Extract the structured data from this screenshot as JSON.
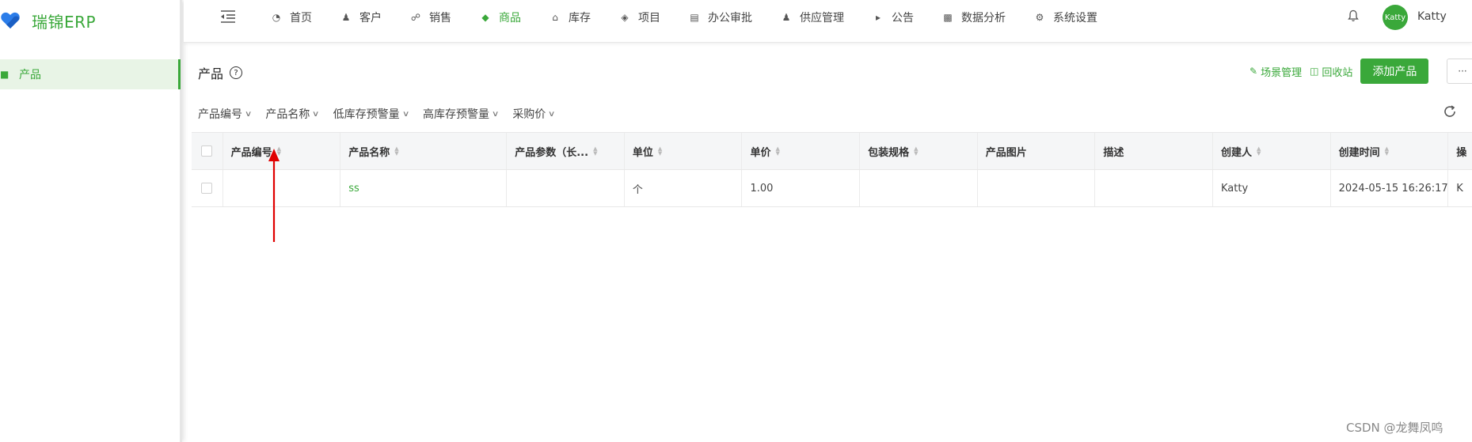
{
  "sidebar": {
    "brand": "瑞锦ERP",
    "items": [
      {
        "label": "产品",
        "icon": "monitor-icon"
      }
    ]
  },
  "topnav": {
    "items": [
      {
        "label": "首页",
        "icon": "dashboard-icon"
      },
      {
        "label": "客户",
        "icon": "users-icon"
      },
      {
        "label": "销售",
        "icon": "cart-icon"
      },
      {
        "label": "商品",
        "icon": "gem-icon",
        "active": true
      },
      {
        "label": "库存",
        "icon": "bank-icon"
      },
      {
        "label": "项目",
        "icon": "layers-icon"
      },
      {
        "label": "办公审批",
        "icon": "document-icon"
      },
      {
        "label": "供应管理",
        "icon": "user-icon"
      },
      {
        "label": "公告",
        "icon": "megaphone-icon"
      },
      {
        "label": "数据分析",
        "icon": "bar-chart-icon"
      },
      {
        "label": "系统设置",
        "icon": "gear-icon"
      }
    ],
    "avatar_text": "Katty",
    "username": "Katty"
  },
  "page": {
    "title": "产品",
    "actions": {
      "scene_manage": "场景管理",
      "recycle_bin": "回收站",
      "add_product": "添加产品",
      "more": "···"
    },
    "filters": [
      "产品编号",
      "产品名称",
      "低库存预警量",
      "高库存预警量",
      "采购价"
    ]
  },
  "table": {
    "columns": [
      "产品编号",
      "产品名称",
      "产品参数（长...",
      "单位",
      "单价",
      "包装规格",
      "产品图片",
      "描述",
      "创建人",
      "创建时间",
      "操"
    ],
    "sortable": [
      true,
      true,
      true,
      true,
      true,
      true,
      false,
      false,
      true,
      true,
      false
    ],
    "rows": [
      [
        "",
        "ss",
        "",
        "个",
        "1.00",
        "",
        "",
        "",
        "Katty",
        "2024-05-15 16:26:17",
        "K"
      ]
    ]
  },
  "colors": {
    "accent": "#3aa83a",
    "annotation_arrow": "#e00000"
  },
  "watermark": "CSDN @龙舞凤鸣"
}
